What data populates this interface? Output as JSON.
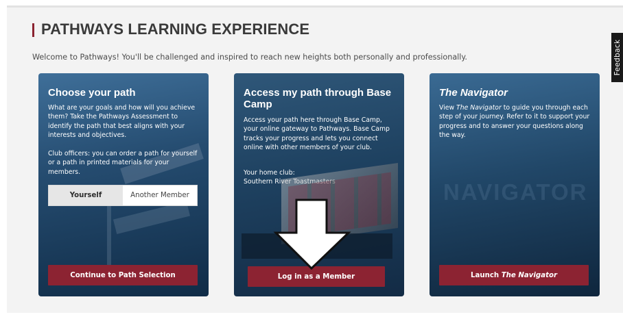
{
  "page": {
    "title": "PATHWAYS LEARNING EXPERIENCE",
    "intro": "Welcome to Pathways! You'll be challenged and inspired to reach new heights both personally and professionally."
  },
  "feedback_tab": {
    "label": "Feedback"
  },
  "cards": {
    "choose_path": {
      "heading": "Choose your path",
      "body1": "What are your goals and how will you achieve them? Take the Pathways Assessment to identify the path that best aligns with your interests and objectives.",
      "body2": "Club officers: you can order a path for yourself or a path in printed materials for your members.",
      "toggle": {
        "yourself": "Yourself",
        "another_member": "Another Member",
        "selected": "Yourself"
      },
      "button": "Continue to Path Selection"
    },
    "base_camp": {
      "heading": "Access my path through Base Camp",
      "body": "Access your path here through Base Camp, your online gateway to Pathways. Base Camp tracks your progress and lets you connect online with other members of your club.",
      "home_club_label": "Your home club:",
      "home_club_name": "Southern River Toastmasters",
      "button": "Log in as a Member"
    },
    "navigator": {
      "heading": "The Navigator",
      "body_prefix": "View ",
      "body_em": "The Navigator",
      "body_suffix": " to guide you through each step of your journey. Refer to it to support your progress and to answer your questions along the way.",
      "watermark": "NAVIGATOR",
      "button_prefix": "Launch ",
      "button_em": "The Navigator"
    }
  },
  "colors": {
    "accent": "#8c2332",
    "title_text": "#3a3a3a",
    "card_blue": "#254c70"
  },
  "annotations": {
    "arrow": "down-arrow-icon"
  }
}
